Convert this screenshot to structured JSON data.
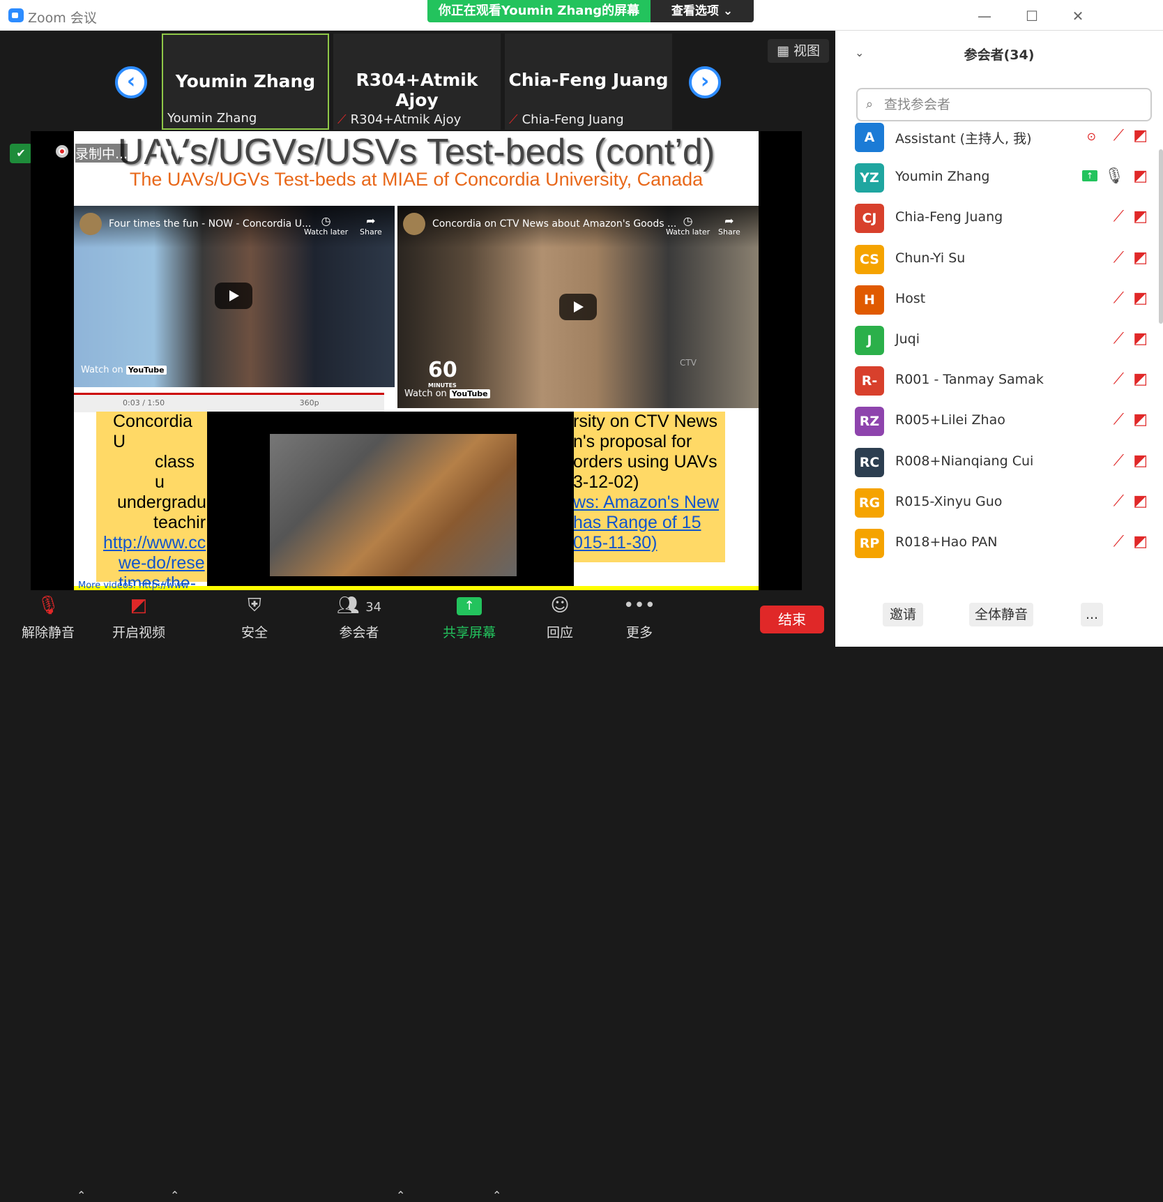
{
  "titlebar": {
    "app_title": "Zoom 会议"
  },
  "banner": {
    "sharing_text": "你正在观看Youmin Zhang的屏幕",
    "view_options": "查看选项 ⌄"
  },
  "view_button": {
    "label": "视图"
  },
  "tiles": [
    {
      "display": "Youmin Zhang",
      "label": "Youmin Zhang"
    },
    {
      "display": "R304+Atmik Ajoy",
      "label": "R304+Atmik Ajoy"
    },
    {
      "display": "Chia-Feng Juang",
      "label": "Chia-Feng Juang"
    }
  ],
  "recording": {
    "text": "录制中..."
  },
  "slide": {
    "title": "UAVs/UGVs/USVs Test-beds (cont’d)",
    "subtitle": "The UAVs/UGVs Test-beds at MIAE of Concordia University, Canada",
    "video1_title": "Four times the fun - NOW - Concordia U...",
    "video2_title": "Concordia on CTV News about Amazon's Goods ...",
    "watch_later": "Watch later",
    "share": "Share",
    "watch_on": "Watch on",
    "youtube": "YouTube",
    "video1_time": "0:03 / 1:50",
    "video1_quality": "360p",
    "sixty": "60",
    "minutes": "MINUTES",
    "ctv": "CTV",
    "left_box": [
      "Concordia U",
      "class u",
      "undergradu",
      "teachir"
    ],
    "left_links": [
      "http://www.cc",
      "we-do/rese",
      "times-the-fu"
    ],
    "right_box": [
      "rsity on CTV News",
      "n's proposal for",
      "orders using UAVs",
      "3-12-02)"
    ],
    "right_links": [
      "ws: Amazon's New",
      "has Range of 15",
      "015-11-30)"
    ],
    "more_videos": "More videos:  http://www"
  },
  "toolbar": {
    "unmute": "解除静音",
    "start_video": "开启视频",
    "security": "安全",
    "participants": "参会者",
    "participant_count": "34",
    "share_screen": "共享屏幕",
    "reactions": "回应",
    "more": "更多",
    "end": "结束"
  },
  "panel": {
    "title": "参会者(34)",
    "search_placeholder": "查找参会者",
    "participants": [
      {
        "initials": "A",
        "name": "Assistant (主持人, 我)",
        "color": "#1b7bd6"
      },
      {
        "initials": "YZ",
        "name": "Youmin Zhang",
        "color": "#1fa6a0"
      },
      {
        "initials": "CJ",
        "name": "Chia-Feng Juang",
        "color": "#d8402c"
      },
      {
        "initials": "CS",
        "name": "Chun-Yi Su",
        "color": "#f5a300"
      },
      {
        "initials": "H",
        "name": "Host",
        "color": "#e05a00"
      },
      {
        "initials": "J",
        "name": "Juqi",
        "color": "#2bb04a"
      },
      {
        "initials": "R-",
        "name": "R001 - Tanmay Samak",
        "color": "#d8402c"
      },
      {
        "initials": "RZ",
        "name": "R005+Lilei Zhao",
        "color": "#8e44ad"
      },
      {
        "initials": "RC",
        "name": "R008+Nianqiang Cui",
        "color": "#2c3e50"
      },
      {
        "initials": "RG",
        "name": "R015-Xinyu Guo",
        "color": "#f5a300"
      },
      {
        "initials": "RP",
        "name": "R018+Hao PAN",
        "color": "#f5a300"
      }
    ],
    "invite": "邀请",
    "mute_all": "全体静音",
    "more": "..."
  }
}
